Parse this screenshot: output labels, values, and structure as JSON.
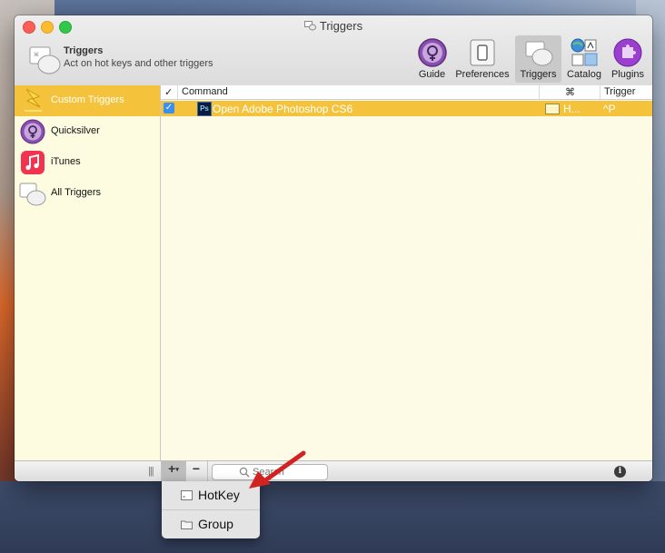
{
  "window": {
    "title": "Triggers"
  },
  "header": {
    "name": "Triggers",
    "subtitle": "Act on hot keys and other triggers"
  },
  "toolbar": {
    "items": [
      {
        "label": "Guide",
        "icon": "quicksilver-guide-icon"
      },
      {
        "label": "Preferences",
        "icon": "preferences-icon"
      },
      {
        "label": "Triggers",
        "icon": "triggers-icon",
        "selected": true
      },
      {
        "label": "Catalog",
        "icon": "catalog-icon"
      },
      {
        "label": "Plugins",
        "icon": "plugins-icon"
      }
    ]
  },
  "sidebar": {
    "items": [
      {
        "label": "Custom Triggers",
        "icon": "lightning-icon",
        "selected": true
      },
      {
        "label": "Quicksilver",
        "icon": "quicksilver-icon"
      },
      {
        "label": "iTunes",
        "icon": "itunes-icon"
      },
      {
        "label": "All Triggers",
        "icon": "triggers-icon"
      }
    ]
  },
  "table": {
    "columns": {
      "enabled": "✓",
      "command": "Command",
      "kind": "⌘",
      "trigger": "Trigger"
    },
    "rows": [
      {
        "enabled": true,
        "command": "Open Adobe Photoshop CS6",
        "kind": "H...",
        "trigger": "^P",
        "icon_text": "Ps"
      }
    ]
  },
  "bottombar": {
    "grip": "|||",
    "add": "+",
    "add_caret": "▾",
    "remove": "−",
    "search_placeholder": "Search",
    "info": "i"
  },
  "popup_menu": {
    "items": [
      {
        "label": "HotKey",
        "icon": "hotkey-icon"
      },
      {
        "label": "Group",
        "icon": "folder-icon"
      }
    ]
  },
  "colors": {
    "selection": "#f5c33b",
    "sidebar_bg": "#fdfbe0",
    "checkbox": "#3b8ff0",
    "arrow": "#d22222"
  }
}
